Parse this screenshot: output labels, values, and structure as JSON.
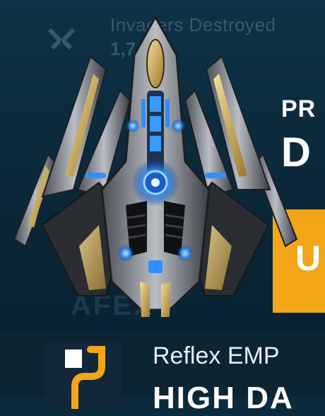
{
  "background_stats": {
    "title": "Invaders Destroyed",
    "count": "1,7"
  },
  "promo": {
    "label": "PR",
    "name": "D",
    "button_label": "U"
  },
  "faded_stats_2": "AFEX",
  "ability": {
    "name": "Reflex EMP",
    "subtitle": "HIGH DA"
  },
  "colors": {
    "background": "#0b2a3c",
    "accent_button": "#f2a516",
    "ship_glow": "#2f8fff",
    "ship_gold": "#c9a24a"
  },
  "icons": {
    "faded_stat_icon": "swords-icon",
    "ability_icon": "emp-icon"
  }
}
